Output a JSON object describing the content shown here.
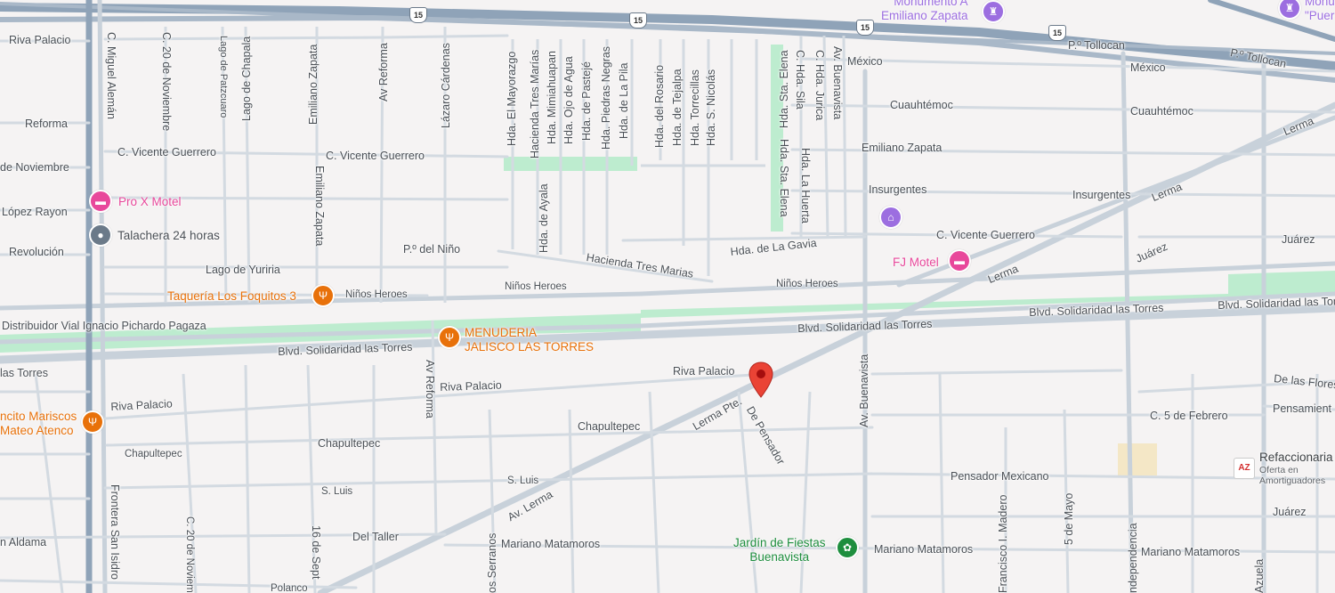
{
  "streets": {
    "riva_palacio_top": "Riva Palacio",
    "c_miguel_aleman": "C. Miguel Alemán",
    "c_20_nov_top": "C. 20 de Noviembre",
    "lago_patzcuaro": "Lago de Patzcuaro",
    "lago_chapala": "Lago de Chapala",
    "emiliano_zapata_top": "Emiliano Zapata",
    "av_reforma_top": "Av Reforma",
    "lazaro_cardenas": "Lázaro Cárdenas",
    "hda_el_mayorazgo": "Hda. El Mayorazgo",
    "hacienda_tres_marias_v": "Hacienda Tres Marías",
    "hda_mimiahuapan": "Hda. Mimiahuapan",
    "hda_ojo_de_agua": "Hda. Ojo de Agua",
    "hda_de_pasteje": "Hda. de Pastejé",
    "hda_piedras_negras": "Hda. Piedras Negras",
    "hda_de_la_pila": "Hda. de La Pila",
    "hda_del_rosario": "Hda. del Rosario",
    "hda_de_tejalpa": "Hda. de Tejalpa",
    "hda_torrecillas": "Hda. Torrecillas",
    "hda_s_nicolas": "Hda. S. Nicolás",
    "hda_sta_elena_1": "Hda. Sta. Elena",
    "hda_sta_elena_2": "Hda. Sta. Elena",
    "c_hda_sila": "C. Hda. Sila",
    "c_hda_jurica": "C. Hda. Jurica",
    "av_buenavista_top": "Av. Buenavista",
    "mexico_1": "México",
    "mexico_2": "México",
    "p_tollocan_1": "P.º Tollocan",
    "p_tollocan_2": "P.º Tollocan",
    "cuauhtemoc_1": "Cuauhtémoc",
    "cuauhtemoc_2": "Cuauhtémoc",
    "emiliano_zapata_h": "Emiliano Zapata",
    "lerma_1": "Lerma",
    "lerma_2": "Lerma",
    "lerma_3": "Lerma",
    "reforma": "Reforma",
    "c_vicente_guerrero_1": "C. Vicente Guerrero",
    "c_vicente_guerrero_2": "C. Vicente Guerrero",
    "c_vicente_guerrero_3": "C. Vicente Guerrero",
    "emiliano_zapata_v2": "Emiliano Zapata",
    "de_noviembre": "de Noviembre",
    "lopez_rayon": "López Rayon",
    "revolucion": "Revolución",
    "insurgentes_1": "Insurgentes",
    "insurgentes_2": "Insurgentes",
    "hda_de_ayala": "Hda. de Ayala",
    "hda_la_huerta": "Hda. La Huerta",
    "juarez_1": "Juárez",
    "juarez_2": "Juárez",
    "juarez_3": "Juárez",
    "p_del_nino": "P.º del Niño",
    "hda_de_la_gavia": "Hda. de La Gavia",
    "lago_de_yuriria": "Lago de Yuriria",
    "hacienda_tres_marias_h": "Hacienda Tres Marias",
    "ninos_heroes_1": "Niños Heroes",
    "ninos_heroes_2": "Niños Heroes",
    "ninos_heroes_3": "Niños Heroes",
    "distribuidor": "Distribuidor Vial Ignacio Pichardo Pagaza",
    "blvd_1": "Blvd. Solidaridad las Torres",
    "blvd_2": "Blvd. Solidaridad las Torres",
    "blvd_3": "Blvd. Solidaridad las Torres",
    "blvd_4": "Blvd. Solidaridad las Torres",
    "las_torres_left": "las Torres",
    "riva_palacio_1": "Riva Palacio",
    "riva_palacio_2": "Riva Palacio",
    "riva_palacio_3": "Riva Palacio",
    "av_reforma_2": "Av Reforma",
    "lerma_pte": "Lerma Pte.",
    "de_pensador": "De Pensador",
    "av_buenavista_2": "Av. Buenavista",
    "de_las_flores": "De las Flores",
    "c_5_de_febrero": "C. 5 de Febrero",
    "pensamiento": "Pensamient",
    "chapultepec_1": "Chapultepec",
    "chapultepec_2": "Chapultepec",
    "chapultepec_3": "Chapultepec",
    "pensador_mexicano": "Pensador Mexicano",
    "s_luis_1": "S. Luis",
    "s_luis_2": "S. Luis",
    "av_lerma": "Av. Lerma",
    "frontera_san_isidro": "Frontera San Isidro",
    "c_20_de_noviembre_bottom": "C. 20 de Noviem",
    "sixteen_sept": "16 de Sept",
    "del_taller": "Del Taller",
    "serranos": "os Serranos",
    "mariano_matamoros_1": "Mariano Matamoros",
    "mariano_matamoros_2": "Mariano Matamoros",
    "mariano_matamoros_3": "Mariano Matamoros",
    "francisco_madero": "Francisco I. Madero",
    "cinco_de_mayo": "5 de Mayo",
    "independencia": "ndependencia",
    "juarez_bottom": "Juárez",
    "n_aldama": "n Aldama",
    "polanco": "Polanco",
    "azuela": "Azuela"
  },
  "highway_shields": [
    "15",
    "15",
    "15",
    "15"
  ],
  "pois": {
    "monumento_line1": "Monumento A",
    "monumento_line2": "Emiliano Zapata",
    "monumento_right_line1": "Monum",
    "monumento_right_line2": "\"Puer",
    "pro_x_motel": "Pro X Motel",
    "talachera": "Talachera 24 horas",
    "taqueria": "Taquería Los Foquitos 3",
    "menuderia_line1": "MENUDERIA",
    "menuderia_line2": "JALISCO LAS TORRES",
    "fj_motel": "FJ Motel",
    "mariscos_line1": "ncito Mariscos",
    "mariscos_line2": "Mateo Atenco",
    "jardin_line1": "Jardín de Fiestas",
    "jardin_line2": "Buenavista",
    "refaccionaria": "Refaccionaria",
    "refaccionaria_sub1": "Oferta en",
    "refaccionaria_sub2": "Amortiguadores"
  },
  "colors": {
    "background": "#f5f3f3",
    "road": "#c8d1da",
    "highway": "#8fa3b8",
    "park": "#bdeccf",
    "lodging_pink": "#e8489b",
    "food_orange": "#e8710a",
    "park_green": "#1e8e3e",
    "shopping_purple": "#9c6ee0",
    "marker_red": "#ea4335",
    "service_gray": "#6b7a89"
  },
  "icons": {
    "lodging": "bed-icon",
    "food": "fork-knife-icon",
    "monument": "monument-icon",
    "service": "circle-icon",
    "garden": "flower-icon",
    "location_pin": "map-pin-icon",
    "autoparts": "autoparts-logo"
  }
}
